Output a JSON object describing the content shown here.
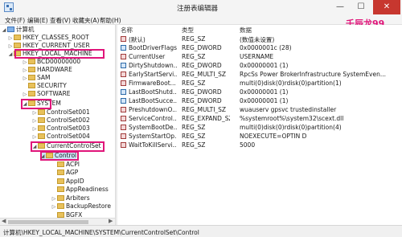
{
  "window": {
    "title": "注册表编辑器",
    "minimize": "—",
    "maximize": "☐",
    "close": "✕"
  },
  "watermark": "壬辰龙99",
  "menu": [
    "文件(F)",
    "编辑(E)",
    "查看(V)",
    "收藏夹(A)",
    "帮助(H)"
  ],
  "tree": [
    {
      "label": "计算机",
      "toggle": "◢"
    },
    {
      "label": "HKEY_CLASSES_ROOT",
      "toggle": "▷"
    },
    {
      "label": "HKEY_CURRENT_USER",
      "toggle": "▷"
    },
    {
      "label": "HKEY_LOCAL_MACHINE",
      "toggle": "◢"
    },
    {
      "label": "BCD00000000",
      "toggle": "▷"
    },
    {
      "label": "HARDWARE",
      "toggle": "▷"
    },
    {
      "label": "SAM",
      "toggle": "▷"
    },
    {
      "label": "SECURITY",
      "toggle": ""
    },
    {
      "label": "SOFTWARE",
      "toggle": "▷"
    },
    {
      "label": "SYSTEM",
      "toggle": "◢"
    },
    {
      "label": "ControlSet001",
      "toggle": "▷"
    },
    {
      "label": "ControlSet002",
      "toggle": "▷"
    },
    {
      "label": "ControlSet003",
      "toggle": "▷"
    },
    {
      "label": "ControlSet004",
      "toggle": "▷"
    },
    {
      "label": "CurrentControlSet",
      "toggle": "◢"
    },
    {
      "label": "Control",
      "toggle": "◢"
    },
    {
      "label": "ACPI",
      "toggle": ""
    },
    {
      "label": "AGP",
      "toggle": ""
    },
    {
      "label": "AppID",
      "toggle": ""
    },
    {
      "label": "AppReadiness",
      "toggle": ""
    },
    {
      "label": "Arbiters",
      "toggle": "▷"
    },
    {
      "label": "BackupRestore",
      "toggle": "▷"
    },
    {
      "label": "BGFX",
      "toggle": ""
    }
  ],
  "hscroll": {
    "left": "◀",
    "right": "▶"
  },
  "columns": {
    "name": "名称",
    "type": "类型",
    "data": "数据"
  },
  "values": [
    {
      "name": "(默认)",
      "type": "REG_SZ",
      "data": "(数值未设置)",
      "kind": "sz"
    },
    {
      "name": "BootDriverFlags",
      "type": "REG_DWORD",
      "data": "0x0000001c (28)",
      "kind": "bin"
    },
    {
      "name": "CurrentUser",
      "type": "REG_SZ",
      "data": "USERNAME",
      "kind": "sz"
    },
    {
      "name": "DirtyShutdown...",
      "type": "REG_DWORD",
      "data": "0x00000001 (1)",
      "kind": "bin"
    },
    {
      "name": "EarlyStartServi...",
      "type": "REG_MULTI_SZ",
      "data": "RpcSs Power BrokerInfrastructure SystemEven...",
      "kind": "sz"
    },
    {
      "name": "FirmwareBoot...",
      "type": "REG_SZ",
      "data": "multi(0)disk(0)rdisk(0)partition(1)",
      "kind": "sz"
    },
    {
      "name": "LastBootShutd...",
      "type": "REG_DWORD",
      "data": "0x00000001 (1)",
      "kind": "bin"
    },
    {
      "name": "LastBootSucce...",
      "type": "REG_DWORD",
      "data": "0x00000001 (1)",
      "kind": "bin"
    },
    {
      "name": "PreshutdownO...",
      "type": "REG_MULTI_SZ",
      "data": "wuauserv gpsvc trustedinstaller",
      "kind": "sz"
    },
    {
      "name": "ServiceControl...",
      "type": "REG_EXPAND_SZ",
      "data": "%systemroot%\\system32\\scext.dll",
      "kind": "sz"
    },
    {
      "name": "SystemBootDe...",
      "type": "REG_SZ",
      "data": "multi(0)disk(0)rdisk(0)partition(4)",
      "kind": "sz"
    },
    {
      "name": "SystemStartOp...",
      "type": "REG_SZ",
      "data": "NOEXECUTE=OPTIN D",
      "kind": "sz"
    },
    {
      "name": "WaitToKillServi...",
      "type": "REG_SZ",
      "data": "5000",
      "kind": "sz"
    }
  ],
  "status": "计算机\\HKEY_LOCAL_MACHINE\\SYSTEM\\CurrentControlSet\\Control",
  "colors": {
    "highlight": "#e0157a",
    "selection": "#cce4f7",
    "close": "#c7372f"
  }
}
